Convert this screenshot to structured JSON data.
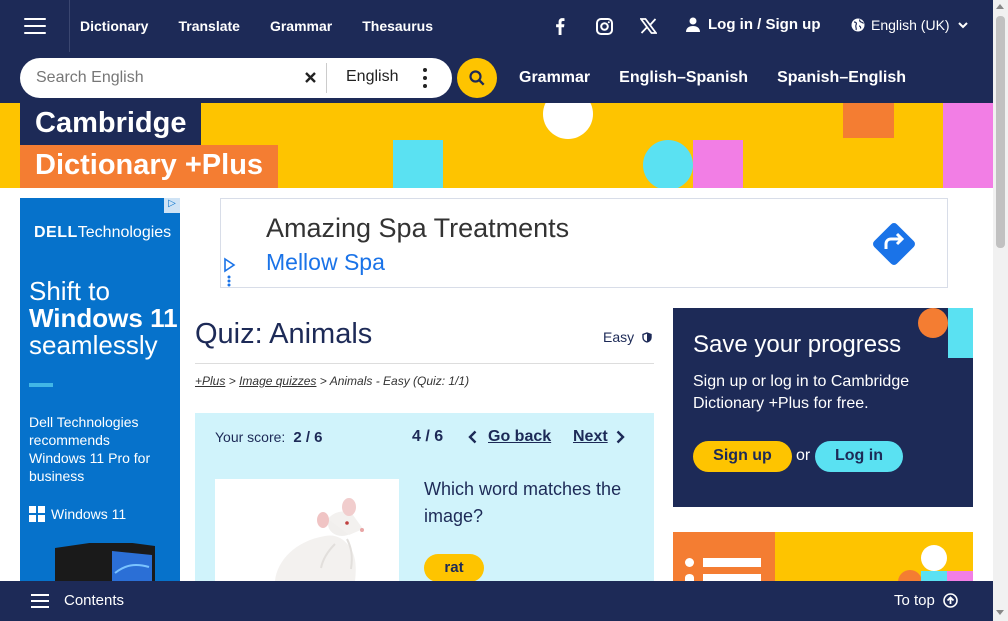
{
  "nav": {
    "links": [
      "Dictionary",
      "Translate",
      "Grammar",
      "Thesaurus"
    ],
    "login": "Log in / Sign up",
    "language": "English (UK)"
  },
  "search": {
    "placeholder": "Search English",
    "dictionary": "English",
    "quick_links": [
      "Grammar",
      "English–Spanish",
      "Spanish–English"
    ]
  },
  "banner": {
    "line1": "Cambridge",
    "line2": "Dictionary +Plus"
  },
  "left_ad": {
    "brand_bold": "DELL",
    "brand_rest": "Technologies",
    "head1": "Shift to",
    "head2": "Windows 11",
    "head3": "seamlessly",
    "body": "Dell Technologies recommends Windows 11 Pro for business",
    "windows": "Windows 11"
  },
  "top_ad": {
    "title": "Amazing Spa Treatments",
    "advertiser": "Mellow Spa"
  },
  "quiz": {
    "title": "Quiz: Animals",
    "level": "Easy",
    "breadcrumb": {
      "plus": "+Plus",
      "sep1": ">",
      "image_quizzes": "Image quizzes",
      "sep2": ">",
      "current": "Animals - Easy (Quiz: 1/1)"
    },
    "score_label": "Your score:",
    "score": "2 / 6",
    "progress": "4 / 6",
    "go_back": "Go back",
    "next": "Next",
    "question": "Which word matches the image?",
    "answer": "rat"
  },
  "save": {
    "title": "Save your progress",
    "text": "Sign up or log in to Cambridge Dictionary +Plus for free.",
    "signup": "Sign up",
    "or": "or",
    "login": "Log in"
  },
  "bottom": {
    "contents": "Contents",
    "to_top": "To top"
  },
  "colors": {
    "navy": "#1d2a57",
    "yellow": "#fec400",
    "orange": "#f47d32",
    "cyan": "#5ae1f2",
    "pink": "#f27ee5",
    "light_cyan": "#d0f3fb",
    "dell_blue": "#0672cb"
  }
}
